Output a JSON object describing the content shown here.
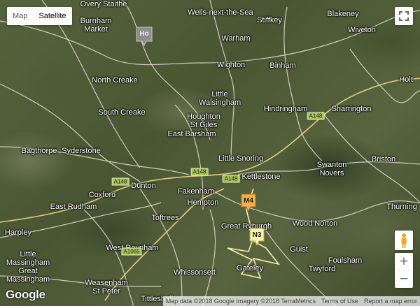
{
  "map_type": {
    "map_label": "Map",
    "satellite_label": "Satellite",
    "selected": "Satellite"
  },
  "places": [
    "Overy Staithe",
    "Burnham Market",
    "Wells-next-the-Sea",
    "Stiffkey",
    "Blakeney",
    "Wiveton",
    "Warham",
    "Wighton",
    "Binham",
    "North Creake",
    "South Creake",
    "Little Walsingham",
    "Houghton St Giles",
    "Hindringham",
    "Sharrington",
    "Holt",
    "East Barsham",
    "Bagthorpe",
    "Syderstone",
    "Little Snoring",
    "Kettlestone",
    "Swanton Novers",
    "Briston",
    "Dunton",
    "Coxford",
    "Fakenham",
    "East Rudham",
    "Hempton",
    "Toftrees",
    "Great Ryburgh",
    "Wood Norton",
    "Thurning",
    "Harpley",
    "West Raynham",
    "Guist",
    "Foulsham",
    "Little Massingham",
    "Great Massingham",
    "Whissonsett",
    "Gateley",
    "Twyford",
    "Weasenham St Peter",
    "Tittleshall",
    "Ho"
  ],
  "road_labels": [
    "A148",
    "A148",
    "A148",
    "A148",
    "A1065"
  ],
  "markers": [
    {
      "label": "M4",
      "color": "#f3b04a"
    },
    {
      "label": "N3",
      "color": "#f7f0a8"
    }
  ],
  "logo": "Google",
  "attribution": {
    "data": "Map data ©2018 Google Imagery ©2018 TerraMetrics",
    "terms": "Terms of Use",
    "report": "Report a map error"
  },
  "colors": {
    "roads": "#e7e3d6",
    "track": "#f5f0b5"
  },
  "icons": {
    "fullscreen": "fullscreen-icon",
    "pegman": "pegman-icon",
    "zoom_in": "plus-icon",
    "zoom_out": "minus-icon"
  }
}
